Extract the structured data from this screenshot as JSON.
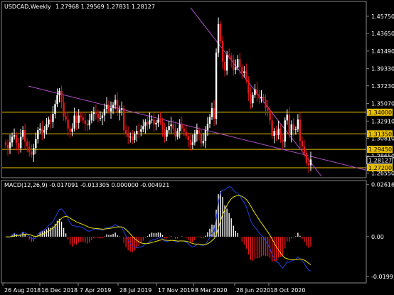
{
  "chart_data": [
    {
      "type": "candlestick",
      "title": "USDCAD,Weekly",
      "ohlc_label": "1.27968 1.29569 1.27831 1.28127",
      "y_ticks": [
        "1.45750",
        "1.43650",
        "1.41490",
        "1.39330",
        "1.37230",
        "1.35070",
        "1.32910",
        "1.30810",
        "1.28650",
        "1.26550"
      ],
      "y_range": [
        1.2615,
        1.474
      ],
      "x_tick_labels": [
        "26 Aug 2018",
        "16 Dec 2018",
        "7 Apr 2019",
        "28 Jul 2019",
        "17 Nov 2019",
        "8 Mar 2020",
        "28 Jun 2020",
        "18 Oct 2020"
      ],
      "levels": [
        {
          "value": 1.34,
          "label": "1.34000",
          "color": "#e8c000"
        },
        {
          "value": 1.3135,
          "label": "1.31350",
          "color": "#e8c000"
        },
        {
          "value": 1.2945,
          "label": "1.29450",
          "color": "#e8c000"
        },
        {
          "value": 1.272,
          "label": "1.27200",
          "color": "#e8c000"
        }
      ],
      "current_price": {
        "value": 1.28127,
        "label": "1.28127"
      },
      "trendlines": [
        {
          "from": [
            "2018-10",
            1.353
          ],
          "to": [
            "2020-12",
            1.278
          ],
          "color": "#b050c8"
        },
        {
          "from": [
            "2020-03",
            1.467
          ],
          "to": [
            "2020-12",
            1.295
          ],
          "color": "#b050c8"
        }
      ],
      "bull_color": "#ffffff",
      "bear_color": "#e01818",
      "weekly_closes": [
        1.3,
        1.296,
        1.303,
        1.31,
        1.312,
        1.302,
        1.296,
        1.31,
        1.318,
        1.304,
        1.298,
        1.291,
        1.288,
        1.296,
        1.307,
        1.318,
        1.32,
        1.315,
        1.318,
        1.325,
        1.331,
        1.328,
        1.338,
        1.35,
        1.361,
        1.366,
        1.352,
        1.335,
        1.331,
        1.32,
        1.316,
        1.32,
        1.336,
        1.327,
        1.336,
        1.334,
        1.33,
        1.326,
        1.324,
        1.33,
        1.338,
        1.34,
        1.338,
        1.333,
        1.333,
        1.336,
        1.344,
        1.349,
        1.341,
        1.345,
        1.349,
        1.355,
        1.339,
        1.343,
        1.345,
        1.318,
        1.313,
        1.31,
        1.31,
        1.306,
        1.313,
        1.317,
        1.316,
        1.319,
        1.323,
        1.328,
        1.325,
        1.33,
        1.331,
        1.325,
        1.327,
        1.331,
        1.328,
        1.319,
        1.31,
        1.318,
        1.323,
        1.325,
        1.32,
        1.31,
        1.317,
        1.325,
        1.32,
        1.316,
        1.311,
        1.306,
        1.3,
        1.303,
        1.313,
        1.318,
        1.313,
        1.302,
        1.305,
        1.318,
        1.326,
        1.334,
        1.345,
        1.332,
        1.413,
        1.448,
        1.427,
        1.402,
        1.391,
        1.41,
        1.409,
        1.404,
        1.392,
        1.395,
        1.405,
        1.395,
        1.388,
        1.39,
        1.379,
        1.363,
        1.351,
        1.361,
        1.368,
        1.362,
        1.357,
        1.359,
        1.355,
        1.345,
        1.342,
        1.33,
        1.311,
        1.317,
        1.312,
        1.32,
        1.306,
        1.304,
        1.33,
        1.337,
        1.312,
        1.325,
        1.318,
        1.319,
        1.331,
        1.305,
        1.298,
        1.29,
        1.278,
        1.275,
        1.282
      ],
      "hl_pad": 0.009
    },
    {
      "type": "macd",
      "label": "MACD(12,26,9) -0.017091 -0.013305 0.000000 -0.004921",
      "y_ticks": [
        "0.026162",
        "0.00",
        "-0.019915"
      ],
      "y_range": [
        -0.0225,
        0.0275
      ],
      "histogram_color_up": "#ffffff",
      "histogram_color_down": "#e01818",
      "signal_color": "#e8e000",
      "macd_color": "#2040e0"
    }
  ]
}
